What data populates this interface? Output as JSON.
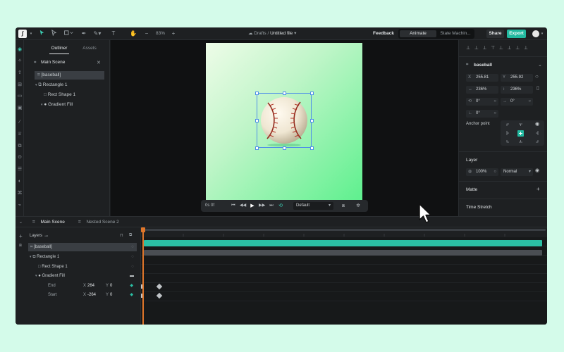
{
  "topbar": {
    "logo": "∫",
    "zoom": "83%",
    "breadcrumb_root": "Drafts",
    "breadcrumb_sep": "/",
    "file_name": "Untitled file",
    "feedback": "Feedback",
    "modes": [
      "Animate",
      "State Machin..."
    ],
    "share": "Share",
    "export": "Export"
  },
  "left_panel": {
    "tabs": [
      "Outliner",
      "Assets"
    ],
    "scene": "Main Scene",
    "tree": [
      {
        "label": "[baseball]"
      },
      {
        "label": "Rectangle 1"
      },
      {
        "label": "Rect Shape 1"
      },
      {
        "label": "Gradient Fill"
      }
    ]
  },
  "playbar": {
    "time": "0s 0f",
    "speed": "Default"
  },
  "right_panel": {
    "object_name": "baseball",
    "x_label": "X",
    "x": "255.81",
    "y_label": "Y",
    "y": "255.92",
    "width": "236%",
    "height": "236%",
    "rotation": "0°",
    "skew_x": "0°",
    "skew_y": "0°",
    "anchor_point": "Anchor point",
    "layer": "Layer",
    "opacity": "100%",
    "blend": "Normal",
    "matte": "Matte",
    "time_stretch": "Time Stretch"
  },
  "timeline": {
    "tabs": [
      "Main Scene",
      "Nested Scene 2"
    ],
    "layers_label": "Layers",
    "rows": [
      {
        "label": "[baseball]"
      },
      {
        "label": "Rectangle 1"
      },
      {
        "label": "Rect Shape 1"
      },
      {
        "label": "Gradient Fill"
      },
      {
        "label": "End",
        "x_label": "X",
        "x": "264",
        "y_label": "Y",
        "y": "0"
      },
      {
        "label": "Start",
        "x_label": "X",
        "x": "-264",
        "y_label": "Y",
        "y": "0"
      }
    ]
  },
  "colors": {
    "accent": "#22b9a0",
    "playhead": "#e0762a",
    "selection": "#4f8fe8"
  }
}
